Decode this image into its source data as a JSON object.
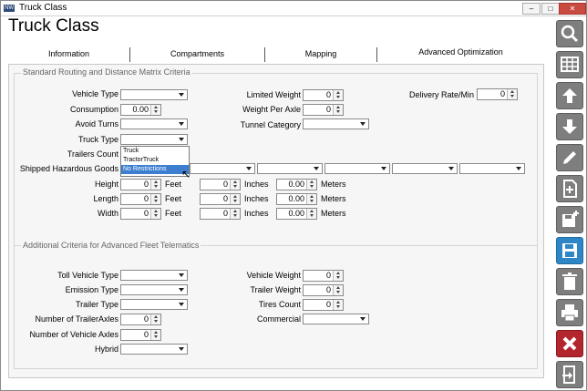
{
  "window": {
    "title": "Truck Class",
    "app_icon": "app-logo-icon",
    "controls": [
      "minimize-icon",
      "maximize-icon",
      "close-icon"
    ]
  },
  "page": {
    "title": "Truck Class"
  },
  "tabs": [
    "Information",
    "Compartments",
    "Mapping",
    "Advanced Optimization"
  ],
  "group1": {
    "legend": "Standard Routing and Distance Matrix Criteria",
    "vehicle_type": {
      "label": "Vehicle Type",
      "value": ""
    },
    "consumption": {
      "label": "Consumption",
      "value": "0.00"
    },
    "avoid_turns": {
      "label": "Avoid Turns",
      "value": ""
    },
    "truck_type": {
      "label": "Truck Type",
      "value": "",
      "options": [
        "Truck",
        "TractorTruck",
        "No Restrictions"
      ],
      "highlighted": "No Restrictions"
    },
    "trailers_count": {
      "label": "Trailers Count"
    },
    "hazardous": {
      "label": "Shipped Hazardous Goods"
    },
    "limited_weight": {
      "label": "Limited Weight",
      "value": "0"
    },
    "weight_per_axle": {
      "label": "Weight Per Axle",
      "value": "0"
    },
    "tunnel_category": {
      "label": "Tunnel Category",
      "value": ""
    },
    "delivery_rate": {
      "label": "Delivery Rate/Min",
      "value": "0"
    },
    "height": {
      "label": "Height",
      "feet": "0",
      "inches": "0",
      "meters": "0.00"
    },
    "length": {
      "label": "Length",
      "feet": "0",
      "inches": "0",
      "meters": "0.00"
    },
    "width": {
      "label": "Width",
      "feet": "0",
      "inches": "0",
      "meters": "0.00"
    },
    "units": {
      "feet": "Feet",
      "inches": "Inches",
      "meters": "Meters"
    }
  },
  "group2": {
    "legend": "Additional Criteria for Advanced Fleet Telematics",
    "toll_vehicle_type": {
      "label": "Toll Vehicle Type",
      "value": ""
    },
    "emission_type": {
      "label": "Emission Type",
      "value": ""
    },
    "trailer_type": {
      "label": "Trailer Type",
      "value": ""
    },
    "trailer_axles": {
      "label": "Number of TrailerAxles",
      "value": "0"
    },
    "vehicle_axles": {
      "label": "Number of Vehicle Axles",
      "value": "0"
    },
    "hybrid": {
      "label": "Hybrid",
      "value": ""
    },
    "vehicle_weight": {
      "label": "Vehicle Weight",
      "value": "0"
    },
    "trailer_weight": {
      "label": "Trailer Weight",
      "value": "0"
    },
    "tires_count": {
      "label": "Tires Count",
      "value": "0"
    },
    "commercial": {
      "label": "Commercial",
      "value": ""
    }
  },
  "sidebar": [
    "search-icon",
    "grid-icon",
    "arrow-up-icon",
    "arrow-down-icon",
    "pencil-icon",
    "new-document-icon",
    "save-new-icon",
    "save-icon",
    "trash-icon",
    "print-icon",
    "close-icon",
    "exit-icon"
  ],
  "colors": {
    "sidebar_button": "#7e7e7e",
    "save_button": "#2e86c6",
    "close_button": "#b4262d",
    "dropdown_highlight": "#3c7fd0"
  }
}
